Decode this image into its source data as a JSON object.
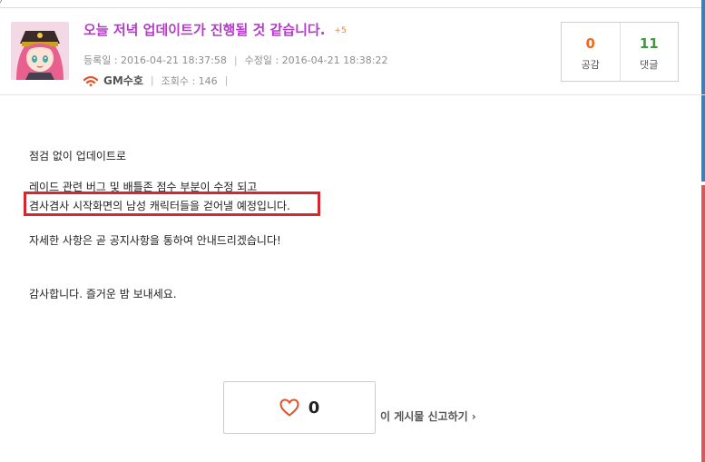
{
  "top_mark": "⁄",
  "post": {
    "title": "오늘 저녁 업데이트가 진행될 것 같습니다.",
    "title_badge": "+5",
    "registered": "등록일 : 2016-04-21 18:37:58",
    "modified": "수정일 : 2016-04-21 18:38:22",
    "author": "GM수호",
    "views": "조회수 : 146"
  },
  "stats": {
    "likes_value": "0",
    "likes_label": "공감",
    "comments_value": "11",
    "comments_label": "댓글"
  },
  "content": {
    "line1": "점검 없이 업데이트로",
    "line2": "레이드 관련 버그 및 배틀존 점수 부분이 수정 되고",
    "line3": "겸사겸사 시작화면의 남성 캐릭터들을 걷어낼 예정입니다.",
    "line4": "자세한 사항은 곧 공지사항을 통하여 안내드리겠습니다!",
    "line5": "감사합니다. 즐거운 밤 보내세요."
  },
  "actions": {
    "like_count": "0",
    "report_label": "이 게시물 신고하기",
    "report_chevron": "›"
  },
  "colors": {
    "title": "#b43cc8",
    "badge": "#ff7a2a",
    "likes": "#ee6b1e",
    "comments": "#3b9c3b",
    "highlight": "#d2282e"
  },
  "icons": [
    "wifi-icon",
    "heart-icon",
    "avatar"
  ]
}
